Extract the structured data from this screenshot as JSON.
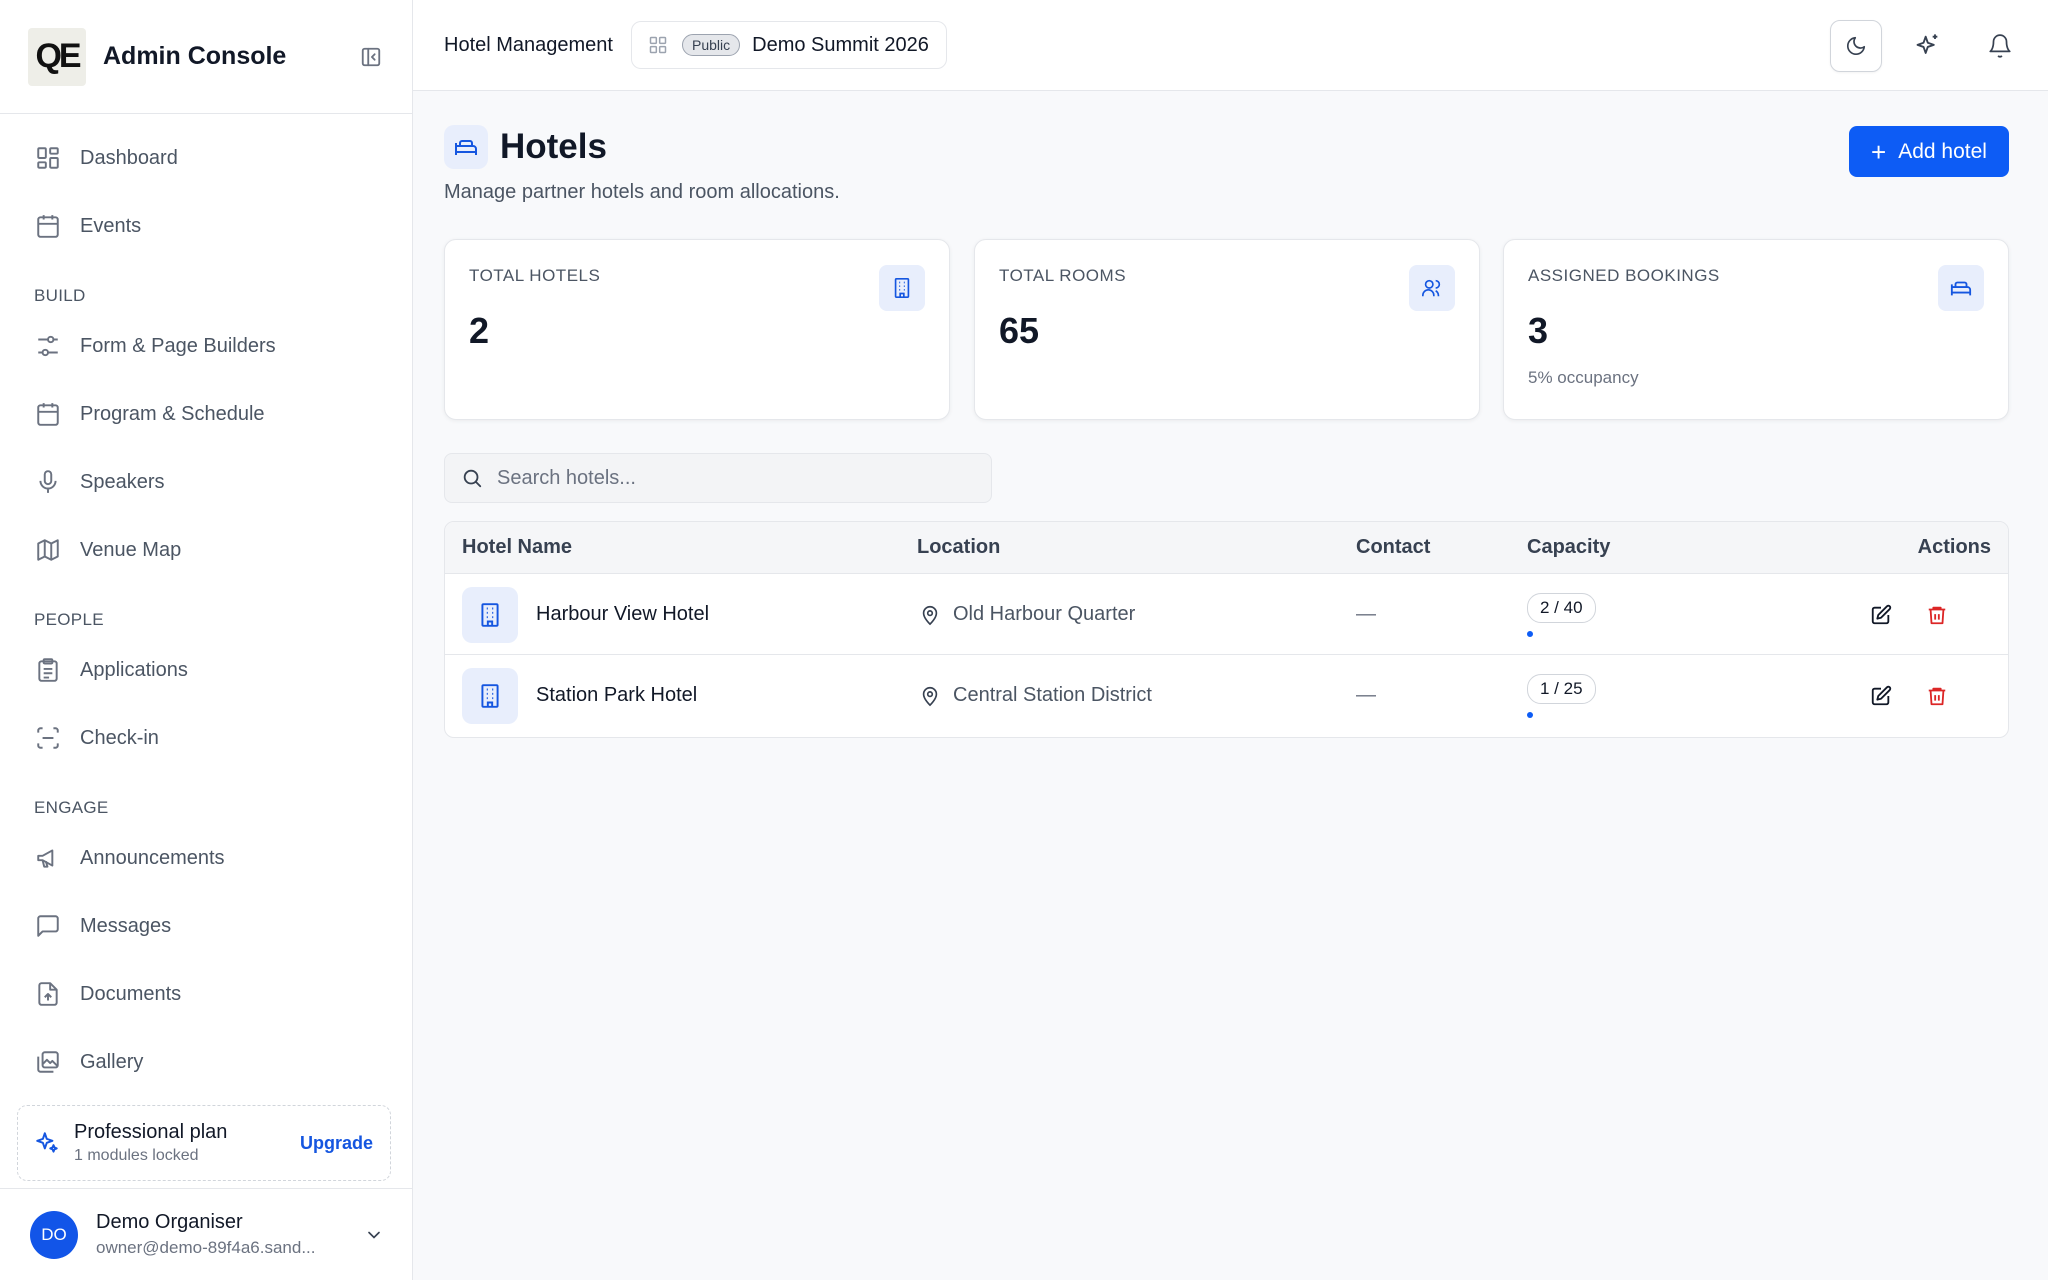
{
  "sidebar": {
    "logo_text": "QE",
    "app_title": "Admin Console",
    "nav_top": [
      {
        "label": "Dashboard",
        "icon": "dashboard-icon"
      },
      {
        "label": "Events",
        "icon": "calendar-icon"
      }
    ],
    "sections": [
      {
        "title": "BUILD",
        "items": [
          {
            "label": "Form & Page Builders",
            "icon": "sliders-icon"
          },
          {
            "label": "Program & Schedule",
            "icon": "calendar-icon"
          },
          {
            "label": "Speakers",
            "icon": "microphone-icon"
          },
          {
            "label": "Venue Map",
            "icon": "map-icon"
          }
        ]
      },
      {
        "title": "PEOPLE",
        "items": [
          {
            "label": "Applications",
            "icon": "clipboard-icon"
          },
          {
            "label": "Check-in",
            "icon": "scan-icon"
          }
        ]
      },
      {
        "title": "ENGAGE",
        "items": [
          {
            "label": "Announcements",
            "icon": "megaphone-icon"
          },
          {
            "label": "Messages",
            "icon": "message-icon"
          },
          {
            "label": "Documents",
            "icon": "document-icon"
          },
          {
            "label": "Gallery",
            "icon": "gallery-icon"
          }
        ]
      }
    ],
    "plan": {
      "name": "Professional plan",
      "sub": "1 modules locked",
      "upgrade_label": "Upgrade"
    },
    "user": {
      "initials": "DO",
      "name": "Demo Organiser",
      "email": "owner@demo-89f4a6.sand..."
    }
  },
  "topbar": {
    "title": "Hotel Management",
    "event_badge": "Public",
    "event_name": "Demo Summit 2026"
  },
  "page": {
    "title": "Hotels",
    "subtitle": "Manage partner hotels and room allocations.",
    "add_button_label": "Add hotel"
  },
  "stats": [
    {
      "label": "TOTAL HOTELS",
      "value": "2",
      "note": "",
      "icon": "building-icon"
    },
    {
      "label": "TOTAL ROOMS",
      "value": "65",
      "note": "",
      "icon": "users-icon"
    },
    {
      "label": "ASSIGNED BOOKINGS",
      "value": "3",
      "note": "5% occupancy",
      "icon": "bed-icon"
    }
  ],
  "search": {
    "placeholder": "Search hotels...",
    "value": ""
  },
  "table": {
    "headers": {
      "name": "Hotel Name",
      "location": "Location",
      "contact": "Contact",
      "capacity": "Capacity",
      "actions": "Actions"
    },
    "rows": [
      {
        "name": "Harbour View Hotel",
        "location": "Old Harbour Quarter",
        "contact": "—",
        "capacity": "2 / 40",
        "fill_fraction": 0.05
      },
      {
        "name": "Station Park Hotel",
        "location": "Central Station District",
        "contact": "—",
        "capacity": "1 / 25",
        "fill_fraction": 0.04
      }
    ]
  },
  "colors": {
    "accent": "#0d5cf5",
    "danger": "#dc2626",
    "icon_bg": "#e8eefc"
  }
}
